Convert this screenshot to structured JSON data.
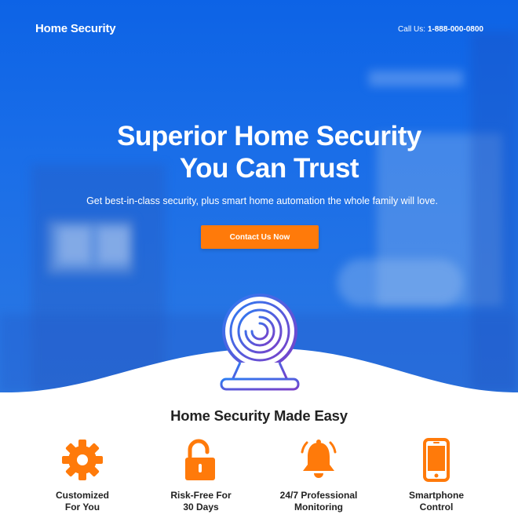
{
  "header": {
    "brand": "Home Security",
    "call_prefix": "Call Us:",
    "phone": "1-888-000-0800"
  },
  "hero": {
    "headline_line1": "Superior Home Security",
    "headline_line2": "You Can Trust",
    "subline": "Get best-in-class security, plus smart home automation the whole family will love.",
    "cta_label": "Contact Us Now"
  },
  "features_section": {
    "title": "Home Security Made Easy",
    "items": [
      {
        "icon": "gear-icon",
        "line1": "Customized",
        "line2": "For You"
      },
      {
        "icon": "unlocked-padlock-icon",
        "line1": "Risk-Free For",
        "line2": "30 Days"
      },
      {
        "icon": "bell-icon",
        "line1": "24/7 Professional",
        "line2": "Monitoring"
      },
      {
        "icon": "smartphone-icon",
        "line1": "Smartphone",
        "line2": "Control"
      }
    ]
  },
  "colors": {
    "hero_blue": "#0d63e6",
    "accent_orange": "#ff7a0a",
    "camera_gradient_start": "#2d7cf2",
    "camera_gradient_end": "#7a3fc8"
  }
}
